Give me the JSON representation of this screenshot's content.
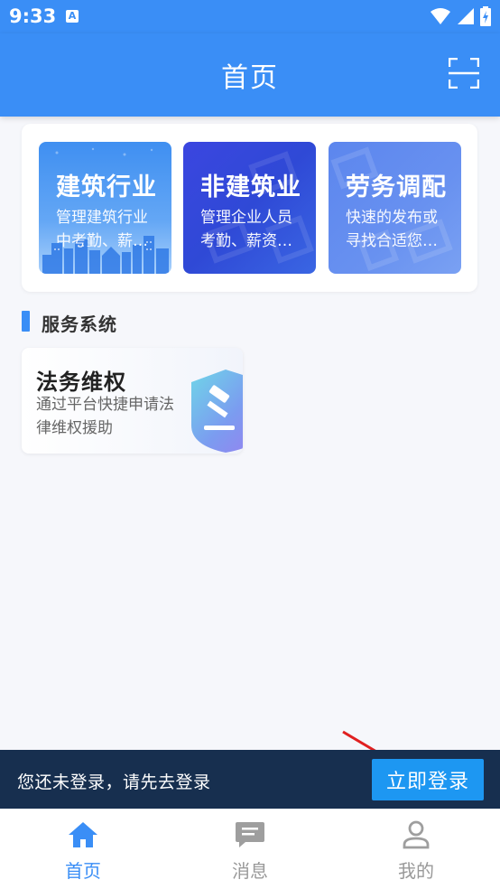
{
  "status_bar": {
    "time": "9:33",
    "notification_icon": "A",
    "icons": [
      "wifi-icon",
      "signal-icon",
      "battery-charging-icon"
    ]
  },
  "app_bar": {
    "title": "首页",
    "action_icon": "scan-icon"
  },
  "industries": [
    {
      "title": "建筑行业",
      "desc": "管理建筑行业中考勤、薪…"
    },
    {
      "title": "非建筑业",
      "desc": "管理企业人员考勤、薪资…"
    },
    {
      "title": "劳务调配",
      "desc": "快速的发布或寻找合适您…"
    }
  ],
  "services_section": {
    "title": "服务系统",
    "items": [
      {
        "title": "法务维权",
        "desc": "通过平台快捷申请法律维权援助",
        "icon": "gavel-shield-icon"
      }
    ]
  },
  "login_banner": {
    "message": "您还未登录，请先去登录",
    "button_label": "立即登录"
  },
  "bottom_nav": [
    {
      "label": "首页",
      "icon": "home-icon",
      "active": true
    },
    {
      "label": "消息",
      "icon": "message-icon",
      "active": false
    },
    {
      "label": "我的",
      "icon": "user-icon",
      "active": false
    }
  ],
  "colors": {
    "primary": "#3a8ef6",
    "banner_bg": "#172f4f",
    "login_button": "#1d97f2",
    "annotation_arrow": "#e02020"
  }
}
